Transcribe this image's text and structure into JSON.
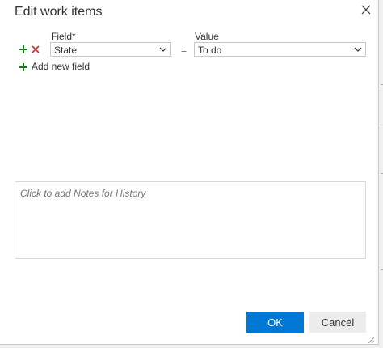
{
  "dialog": {
    "title": "Edit work items"
  },
  "fields": {
    "field_header": "Field*",
    "value_header": "Value",
    "rows": [
      {
        "field": "State",
        "operator": "=",
        "value": "To do"
      }
    ],
    "add_new_field_label": "Add new field"
  },
  "notes": {
    "placeholder": "Click to add Notes for History"
  },
  "buttons": {
    "ok_label": "OK",
    "cancel_label": "Cancel"
  },
  "icons": {
    "close": "close-icon",
    "add": "plus-icon",
    "remove": "x-icon",
    "dropdown": "chevron-down-icon",
    "resize": "resize-grip-icon"
  },
  "colors": {
    "primary_button": "#0078d4",
    "add_green": "#107c10",
    "remove_red": "#d13438"
  }
}
